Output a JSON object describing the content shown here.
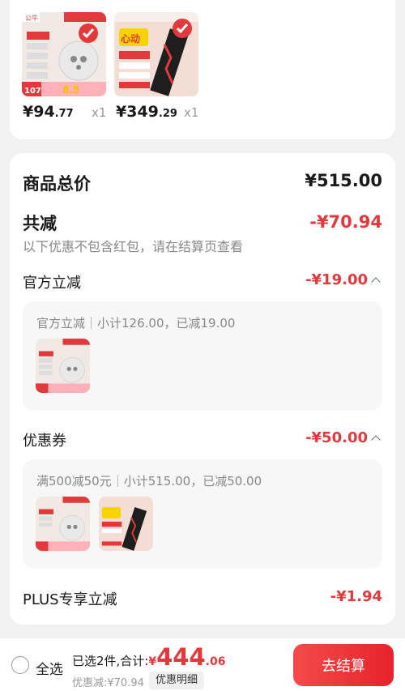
{
  "top_card": {
    "items": [
      {
        "price_int": "¥94",
        "price_dec": ".77",
        "qty": "x1",
        "brand_text": "公牛",
        "image": "power-strip-product"
      },
      {
        "price_int": "¥349",
        "price_dec": ".29",
        "qty": "x1",
        "brand_text": "心动",
        "image": "ssd-product"
      }
    ]
  },
  "summary_card": {
    "total_label": "商品总价",
    "total_value": "¥515.00",
    "discount_label": "共减",
    "discount_value": "-¥70.94",
    "discount_note": "以下优惠不包含红包，请在结算页查看",
    "official": {
      "label": "官方立减",
      "value": "-¥19.00",
      "box_label": "官方立减",
      "box_detail": "小计126.00，已减19.00"
    },
    "coupon": {
      "label": "优惠券",
      "value": "-¥50.00",
      "box_label": "满500减50元",
      "box_detail": "小计515.00，已减50.00"
    },
    "plus": {
      "label": "PLUS专享立减",
      "value": "-¥1.94"
    }
  },
  "bottom_bar": {
    "select_all": "全选",
    "selected_text": "已选2件,合计:",
    "total_yen": "¥",
    "total_int": "444",
    "total_dec": ".06",
    "discount_line": "优惠减:¥70.94",
    "detail_button": "优惠明细",
    "checkout_button": "去结算"
  },
  "colors": {
    "accent_red": "#e4393c",
    "checkout_gradient_start": "#f64a4a",
    "checkout_gradient_end": "#e5242b"
  }
}
